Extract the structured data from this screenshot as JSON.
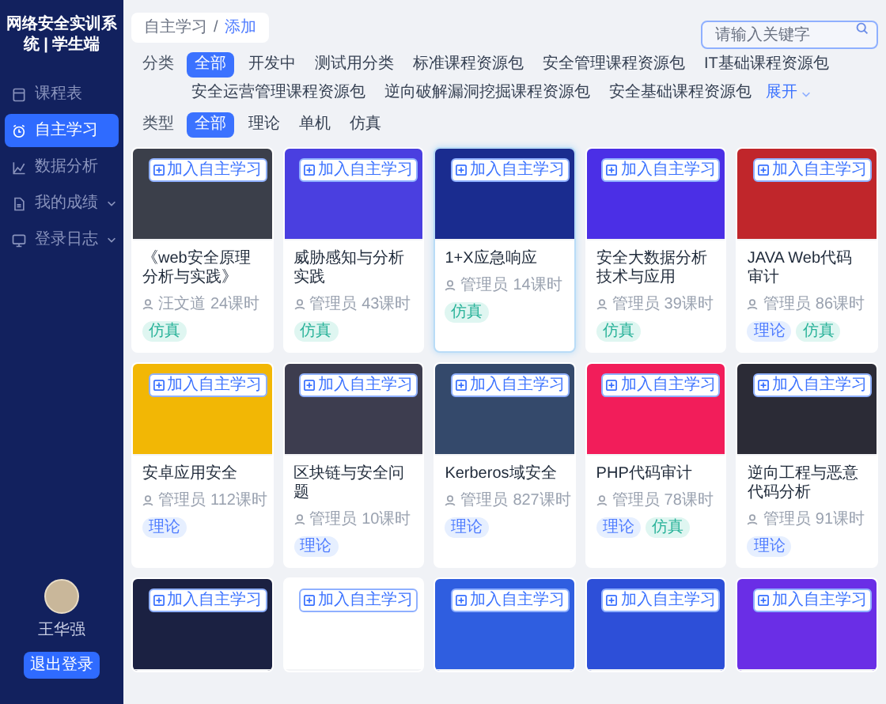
{
  "sidebar": {
    "title": "网络安全实训系统 | 学生端",
    "items": [
      {
        "label": "课程表",
        "selected": false,
        "submenu": false
      },
      {
        "label": "自主学习",
        "selected": true,
        "submenu": false
      },
      {
        "label": "数据分析",
        "selected": false,
        "submenu": false
      },
      {
        "label": "我的成绩",
        "selected": false,
        "submenu": true
      },
      {
        "label": "登录日志",
        "selected": false,
        "submenu": true
      }
    ],
    "user": {
      "name": "王华强"
    },
    "logout": "退出登录"
  },
  "breadcrumb": {
    "items": [
      {
        "label": "自主学习",
        "selected": false
      },
      {
        "label": "添加",
        "selected": true
      }
    ],
    "separator": "/"
  },
  "search": {
    "placeholder": "请输入关键字"
  },
  "filters": [
    {
      "label": "分类",
      "more": "展开",
      "options": [
        {
          "label": "全部",
          "selected": true
        },
        {
          "label": "开发中",
          "selected": false
        },
        {
          "label": "测试用分类",
          "selected": false
        },
        {
          "label": "标准课程资源包",
          "selected": false
        },
        {
          "label": "安全管理课程资源包",
          "selected": false
        },
        {
          "label": "IT基础课程资源包",
          "selected": false
        },
        {
          "label": "安全运营管理课程资源包",
          "selected": false
        },
        {
          "label": "逆向破解漏洞挖掘课程资源包",
          "selected": false
        },
        {
          "label": "安全基础课程资源包",
          "selected": false
        }
      ]
    },
    {
      "label": "类型",
      "options": [
        {
          "label": "全部",
          "selected": true
        },
        {
          "label": "理论",
          "selected": false
        },
        {
          "label": "单机",
          "selected": false
        },
        {
          "label": "仿真",
          "selected": false
        }
      ]
    }
  ],
  "courses": [
    {
      "action": "加入自主学习",
      "title": "《web安全原理分析与实践》",
      "author": "汪文道",
      "hours": "24课时",
      "selected": false,
      "tags": [
        {
          "label": "仿真",
          "kind": "sim"
        }
      ]
    },
    {
      "action": "加入自主学习",
      "title": "威胁感知与分析实践",
      "author": "管理员",
      "hours": "43课时",
      "selected": false,
      "tags": [
        {
          "label": "仿真",
          "kind": "sim"
        }
      ]
    },
    {
      "action": "加入自主学习",
      "title": "1+X应急响应",
      "author": "管理员",
      "hours": "14课时",
      "selected": true,
      "tags": [
        {
          "label": "仿真",
          "kind": "sim"
        }
      ]
    },
    {
      "action": "加入自主学习",
      "title": "安全大数据分析技术与应用",
      "author": "管理员",
      "hours": "39课时",
      "selected": false,
      "tags": [
        {
          "label": "仿真",
          "kind": "sim"
        }
      ]
    },
    {
      "action": "加入自主学习",
      "title": "JAVA Web代码审计",
      "author": "管理员",
      "hours": "86课时",
      "selected": false,
      "tags": [
        {
          "label": "理论",
          "kind": "theory"
        },
        {
          "label": "仿真",
          "kind": "sim"
        }
      ]
    },
    {
      "action": "加入自主学习",
      "title": "安卓应用安全",
      "author": "管理员",
      "hours": "112课时",
      "selected": false,
      "tags": [
        {
          "label": "理论",
          "kind": "theory"
        }
      ]
    },
    {
      "action": "加入自主学习",
      "title": "区块链与安全问题",
      "author": "管理员",
      "hours": "10课时",
      "selected": false,
      "tags": [
        {
          "label": "理论",
          "kind": "theory"
        }
      ]
    },
    {
      "action": "加入自主学习",
      "title": "Kerberos域安全",
      "author": "管理员",
      "hours": "827课时",
      "selected": false,
      "tags": [
        {
          "label": "理论",
          "kind": "theory"
        }
      ]
    },
    {
      "action": "加入自主学习",
      "title": "PHP代码审计",
      "author": "管理员",
      "hours": "78课时",
      "selected": false,
      "tags": [
        {
          "label": "理论",
          "kind": "theory"
        },
        {
          "label": "仿真",
          "kind": "sim"
        }
      ]
    },
    {
      "action": "加入自主学习",
      "title": "逆向工程与恶意代码分析",
      "author": "管理员",
      "hours": "91课时",
      "selected": false,
      "tags": [
        {
          "label": "理论",
          "kind": "theory"
        }
      ]
    },
    {
      "action": "加入自主学习",
      "selected": false
    },
    {
      "action": "加入自主学习",
      "selected": false
    },
    {
      "action": "加入自主学习",
      "selected": false
    },
    {
      "action": "加入自主学习",
      "selected": false
    },
    {
      "action": "加入自主学习",
      "selected": false
    }
  ]
}
